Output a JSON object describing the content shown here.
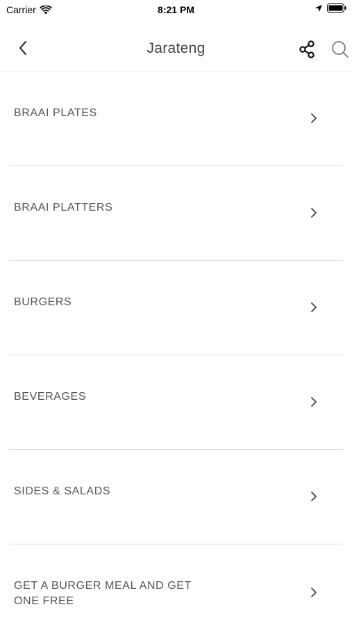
{
  "status_bar": {
    "carrier": "Carrier",
    "time": "8:21 PM"
  },
  "nav": {
    "title": "Jarateng",
    "back_icon": "chevron-left-icon",
    "share_icon": "share-icon",
    "search_icon": "search-icon"
  },
  "menu": {
    "items": [
      {
        "label": "BRAAI PLATES"
      },
      {
        "label": "BRAAI PLATTERS"
      },
      {
        "label": "BURGERS"
      },
      {
        "label": "BEVERAGES"
      },
      {
        "label": "SIDES & SALADS"
      },
      {
        "label": "GET A BURGER MEAL AND GET ONE FREE"
      }
    ]
  },
  "colors": {
    "text": "#555555",
    "divider": "#dcdcdc",
    "title": "#444444"
  }
}
